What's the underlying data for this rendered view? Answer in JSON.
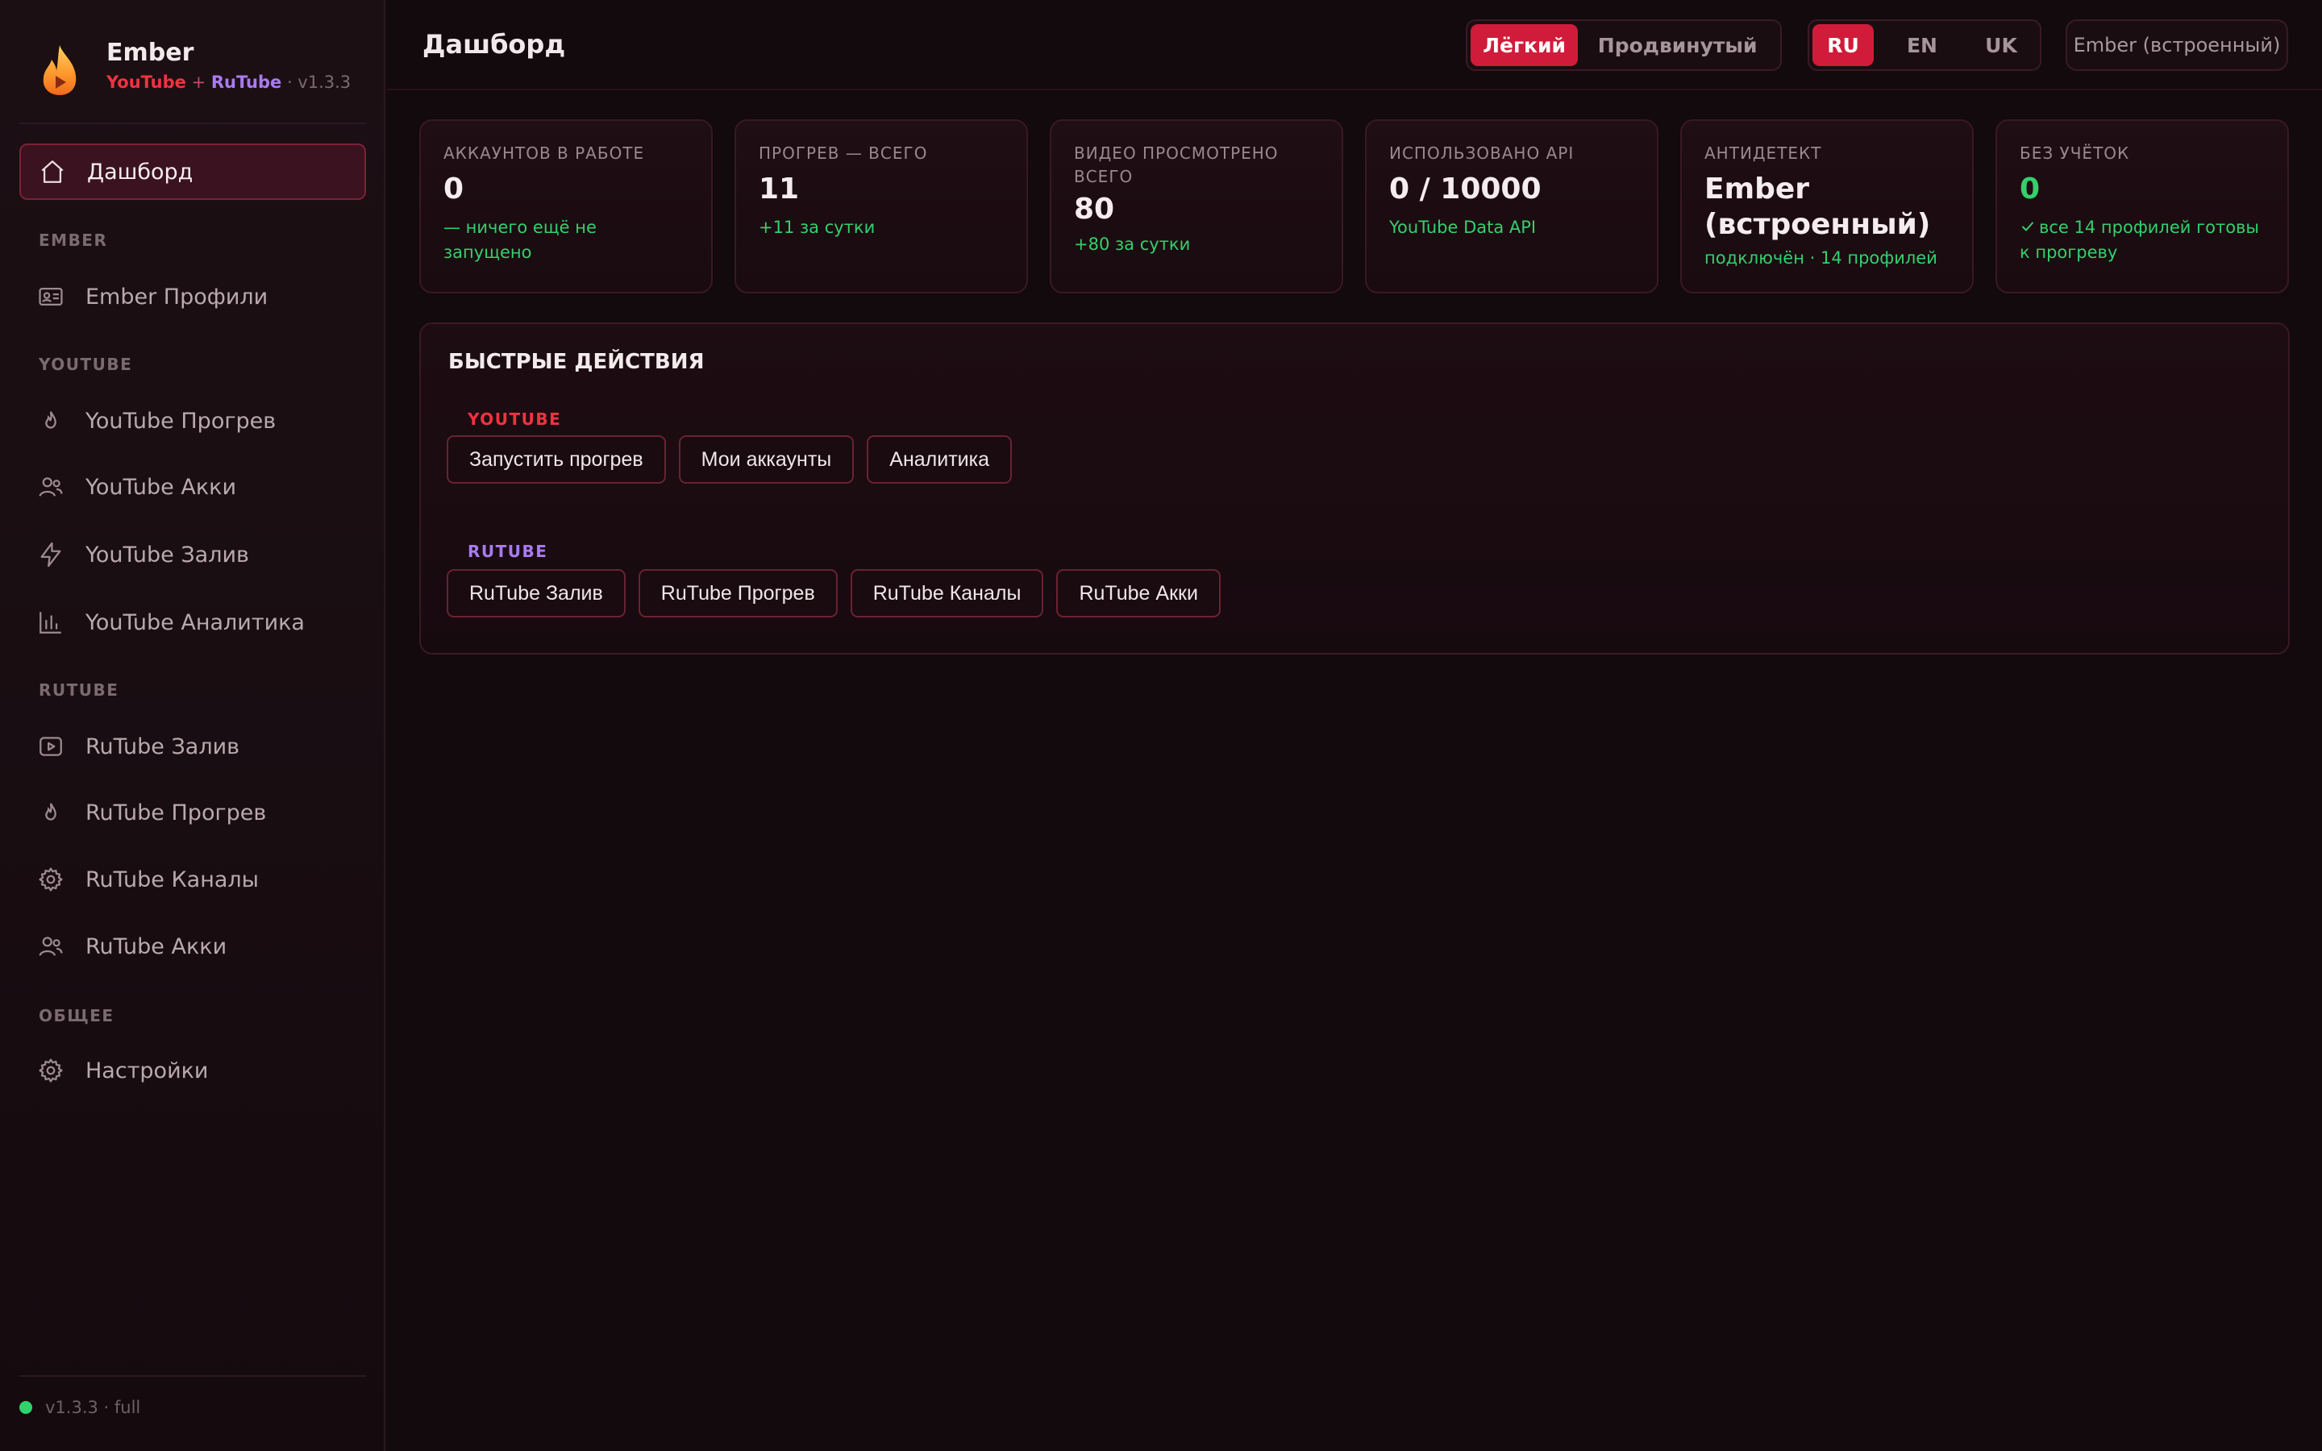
{
  "brand": {
    "name": "Ember",
    "youtube": "YouTube",
    "plus": "+",
    "rutube": "RuTube",
    "version": "· v1.3.3"
  },
  "sidebar": {
    "dashboard": {
      "label": "Дашборд",
      "icon": "home-icon"
    },
    "sections": {
      "ember": "EMBER",
      "youtube": "YOUTUBE",
      "rutube": "RUTUBE",
      "general": "ОБЩЕЕ"
    },
    "ember_items": [
      {
        "label": "Ember Профили",
        "icon": "id-card-icon"
      }
    ],
    "youtube_items": [
      {
        "label": "YouTube Прогрев",
        "icon": "flame-icon"
      },
      {
        "label": "YouTube Акки",
        "icon": "users-icon"
      },
      {
        "label": "YouTube Залив",
        "icon": "bolt-icon"
      },
      {
        "label": "YouTube Аналитика",
        "icon": "bar-chart-icon"
      }
    ],
    "rutube_items": [
      {
        "label": "RuTube Залив",
        "icon": "play-box-icon"
      },
      {
        "label": "RuTube Прогрев",
        "icon": "flame-icon"
      },
      {
        "label": "RuTube Каналы",
        "icon": "gear-icon"
      },
      {
        "label": "RuTube Акки",
        "icon": "users-icon"
      }
    ],
    "general_items": [
      {
        "label": "Настройки",
        "icon": "gear-icon"
      }
    ],
    "footer": "v1.3.3 · full"
  },
  "header": {
    "title": "Дашборд",
    "mode": {
      "easy": "Лёгкий",
      "advanced": "Продвинутый",
      "selected": "Лёгкий"
    },
    "languages": [
      "RU",
      "EN",
      "UK"
    ],
    "language_selected": "RU",
    "engine": "Ember (встроенный)"
  },
  "stats": [
    {
      "label": "АККАУНТОВ В РАБОТЕ",
      "value": "0",
      "sub": "— ничего ещё не запущено"
    },
    {
      "label": "ПРОГРЕВ — ВСЕГО",
      "value": "11",
      "sub": "+11 за сутки"
    },
    {
      "label": "ВИДЕО ПРОСМОТРЕНО ВСЕГО",
      "value": "80",
      "sub": "+80 за сутки"
    },
    {
      "label": "ИСПОЛЬЗОВАНО API",
      "value": "0 / 10000",
      "sub": "YouTube Data API"
    },
    {
      "label": "АНТИДЕТЕКТ",
      "value": "Ember (встроенный)",
      "sub": "подключён · 14 профилей"
    },
    {
      "label": "БЕЗ УЧЁТОК",
      "value": "0",
      "sub": "все 14 профилей готовы к прогреву"
    }
  ],
  "quick_actions": {
    "title": "БЫСТРЫЕ ДЕЙСТВИЯ",
    "youtube_label": "YOUTUBE",
    "youtube_buttons": [
      "Запустить прогрев",
      "Мои аккаунты",
      "Аналитика"
    ],
    "rutube_label": "RUTUBE",
    "rutube_buttons": [
      "RuTube Залив",
      "RuTube Прогрев",
      "RuTube Каналы",
      "RuTube Акки"
    ]
  },
  "colors": {
    "accent": "#d01c3a",
    "youtube": "#ef3340",
    "rutube": "#a97bf0",
    "success": "#33d06c",
    "background": "#120a0d"
  }
}
